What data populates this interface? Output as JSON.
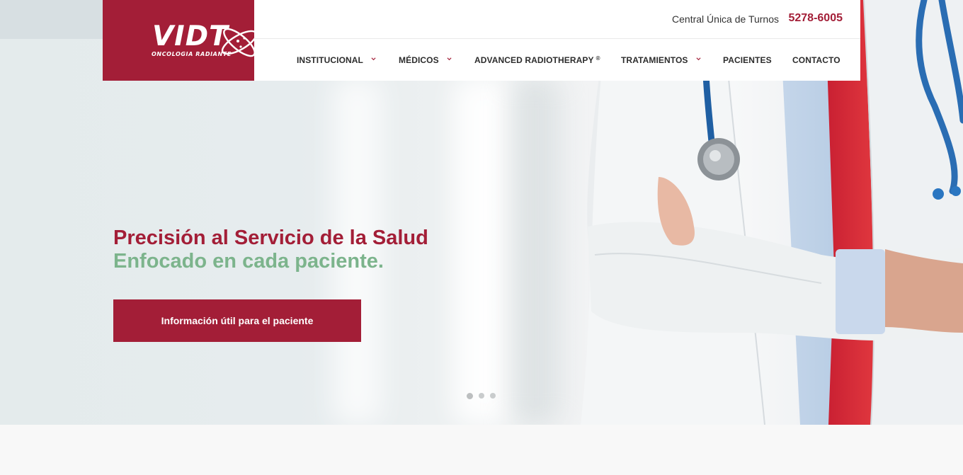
{
  "brand": {
    "logo_text": "VIDT",
    "logo_subtitle": "ONCOLOGIA RADIANTE",
    "color": "#a31e37"
  },
  "header": {
    "phone_label": "Central Única de Turnos",
    "phone_number": "5278-6005"
  },
  "nav": {
    "items": [
      {
        "label": "INSTITUCIONAL",
        "has_dropdown": true
      },
      {
        "label": "MÉDICOS",
        "has_dropdown": true
      },
      {
        "label": "ADVANCED RADIOTHERAPY",
        "sup": "®",
        "has_dropdown": false
      },
      {
        "label": "TRATAMIENTOS",
        "has_dropdown": true
      },
      {
        "label": "PACIENTES",
        "has_dropdown": false
      },
      {
        "label": "CONTACTO",
        "has_dropdown": false
      }
    ]
  },
  "hero": {
    "headline_line1": "Precisión al Servicio de la Salud",
    "headline_line2": "Enfocado en cada paciente.",
    "cta_label": "Información útil para el paciente",
    "accent_green": "#7cb48c",
    "slides_count": 3,
    "active_slide": 1
  }
}
